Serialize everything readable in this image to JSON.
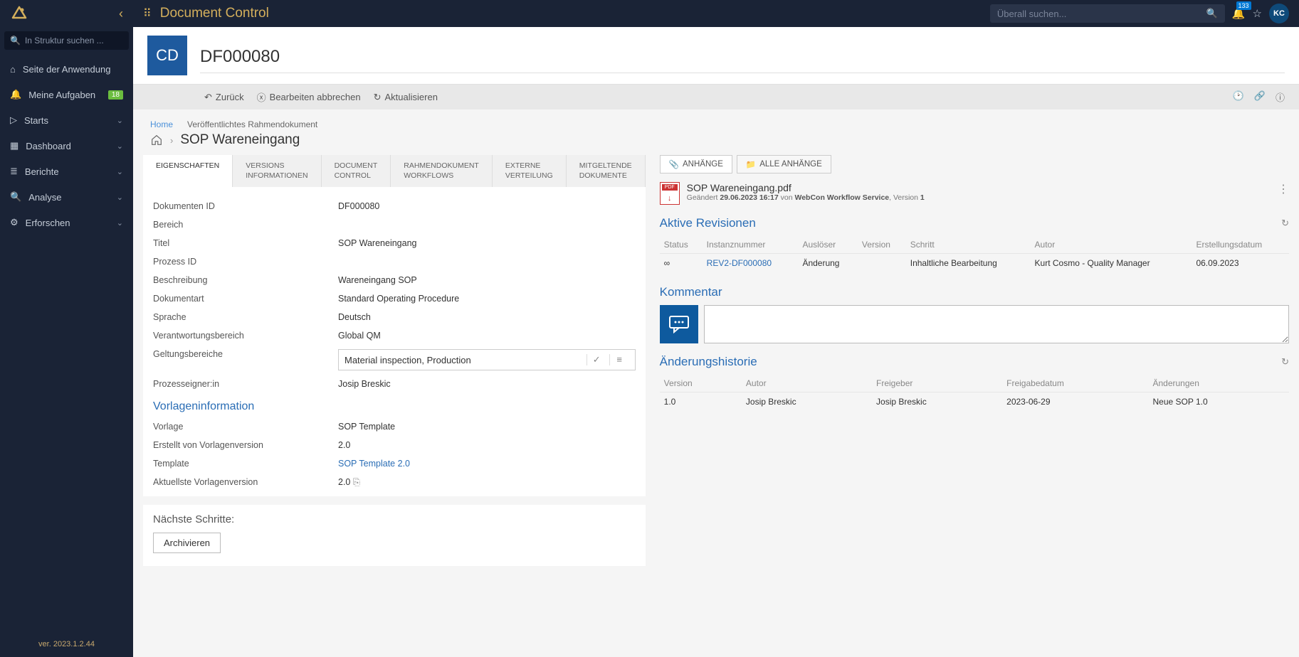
{
  "topbar": {
    "app_title": "Document Control",
    "search_placeholder": "Überall suchen...",
    "bell_count": "133",
    "avatar": "KC"
  },
  "sidebar": {
    "search_placeholder": "In Struktur suchen ...",
    "items": [
      {
        "icon": "home",
        "label": "Seite der Anwendung"
      },
      {
        "icon": "bell",
        "label": "Meine Aufgaben",
        "badge": "18"
      },
      {
        "icon": "play",
        "label": "Starts",
        "chev": true
      },
      {
        "icon": "dash",
        "label": "Dashboard",
        "chev": true
      },
      {
        "icon": "report",
        "label": "Berichte",
        "chev": true
      },
      {
        "icon": "analyse",
        "label": "Analyse",
        "chev": true
      },
      {
        "icon": "explore",
        "label": "Erforschen",
        "chev": true
      }
    ],
    "version": "ver. 2023.1.2.44"
  },
  "header": {
    "badge": "CD",
    "doc_id": "DF000080"
  },
  "actions": {
    "back": "Zurück",
    "cancel_edit": "Bearbeiten abbrechen",
    "refresh": "Aktualisieren"
  },
  "breadcrumb": {
    "home": "Home",
    "path": "Veröffentlichtes Rahmendokument",
    "title": "SOP Wareneingang"
  },
  "tabs": [
    {
      "l1": "EIGENSCHAFTEN",
      "l2": "",
      "active": true
    },
    {
      "l1": "VERSIONS",
      "l2": "INFORMATIONEN"
    },
    {
      "l1": "DOCUMENT",
      "l2": "CONTROL"
    },
    {
      "l1": "RAHMENDOKUMENT",
      "l2": "WORKFLOWS"
    },
    {
      "l1": "EXTERNE",
      "l2": "VERTEILUNG"
    },
    {
      "l1": "MITGELTENDE",
      "l2": "DOKUMENTE"
    }
  ],
  "fields": [
    {
      "label": "Dokumenten ID",
      "value": "DF000080"
    },
    {
      "label": "Bereich",
      "value": ""
    },
    {
      "label": "Titel",
      "value": "SOP Wareneingang"
    },
    {
      "label": "Prozess ID",
      "value": ""
    },
    {
      "label": "Beschreibung",
      "value": "Wareneingang SOP"
    },
    {
      "label": "Dokumentart",
      "value": "Standard Operating Procedure"
    },
    {
      "label": "Sprache",
      "value": "Deutsch"
    },
    {
      "label": "Verantwortungsbereich",
      "value": "Global QM"
    }
  ],
  "scopes": {
    "label": "Geltungsbereiche",
    "values": "Material inspection,   Production"
  },
  "owner": {
    "label": "Prozesseigner:in",
    "value": "Josip Breskic"
  },
  "template_section": "Vorlageninformation",
  "template_fields": [
    {
      "label": "Vorlage",
      "value": "SOP Template"
    },
    {
      "label": "Erstellt von Vorlagenversion",
      "value": "2.0"
    },
    {
      "label": "Template",
      "value": "SOP Template 2.0",
      "link": true
    },
    {
      "label": "Aktuellste Vorlagenversion",
      "value": "2.0",
      "copy": true
    }
  ],
  "next_steps": {
    "title": "Nächste Schritte:",
    "button": "Archivieren"
  },
  "attach_tabs": {
    "a": "ANHÄNGE",
    "b": "ALLE ANHÄNGE"
  },
  "attachment": {
    "name": "SOP Wareneingang.pdf",
    "meta_prefix": "Geändert",
    "date": "29.06.2023 16:17",
    "by": "von",
    "user": "WebCon Workflow Service",
    "ver_label": "Version",
    "ver": "1"
  },
  "revisions": {
    "title": "Aktive Revisionen",
    "headers": [
      "Status",
      "Instanznummer",
      "Auslöser",
      "Version",
      "Schritt",
      "Autor",
      "Erstellungsdatum"
    ],
    "rows": [
      {
        "status": "∞",
        "inst": "REV2-DF000080",
        "trigger": "Änderung",
        "version": "",
        "step": "Inhaltliche Bearbeitung",
        "author": "Kurt Cosmo - Quality Manager",
        "date": "06.09.2023"
      }
    ]
  },
  "comment": {
    "title": "Kommentar"
  },
  "history": {
    "title": "Änderungshistorie",
    "headers": [
      "Version",
      "Autor",
      "Freigeber",
      "Freigabedatum",
      "Änderungen"
    ],
    "rows": [
      {
        "v": "1.0",
        "author": "Josip Breskic",
        "releaser": "Josip Breskic",
        "date": "2023-06-29",
        "changes": "Neue SOP 1.0"
      }
    ]
  }
}
